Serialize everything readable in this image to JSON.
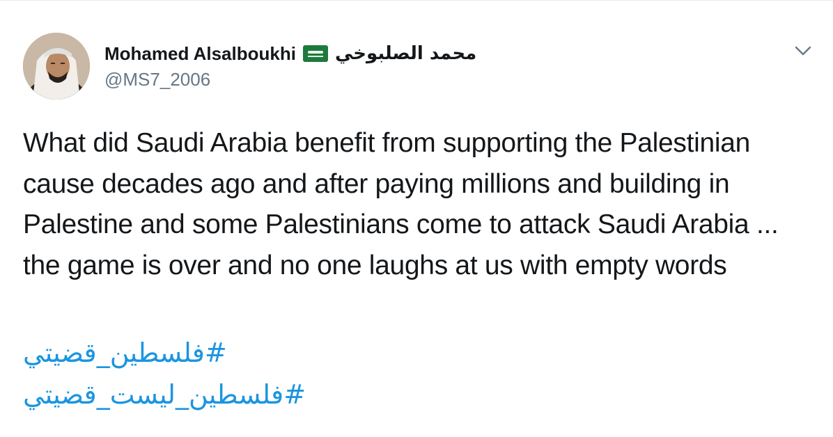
{
  "tweet": {
    "author": {
      "display_name": "Mohamed Alsalboukhi",
      "flag_icon": "saudi-arabia-flag-icon",
      "arabic_name": "محمد الصلبوخي",
      "handle": "@MS7_2006"
    },
    "body": "What did Saudi Arabia benefit from supporting the Palestinian cause decades ago and after paying millions and building in Palestine and some Palestinians come to attack Saudi Arabia ... the game is over and no one laughs at us with empty words",
    "hashtags": [
      {
        "text": "#فلسطين_قضيتي"
      },
      {
        "text": "#فلسطين_ليست_قضيتي"
      }
    ],
    "menu_icon": "chevron-down-icon"
  },
  "colors": {
    "text": "#14171a",
    "secondary": "#657786",
    "link": "#1b95e0",
    "border": "#e6ecf0",
    "flag_green": "#1e7a3c"
  }
}
